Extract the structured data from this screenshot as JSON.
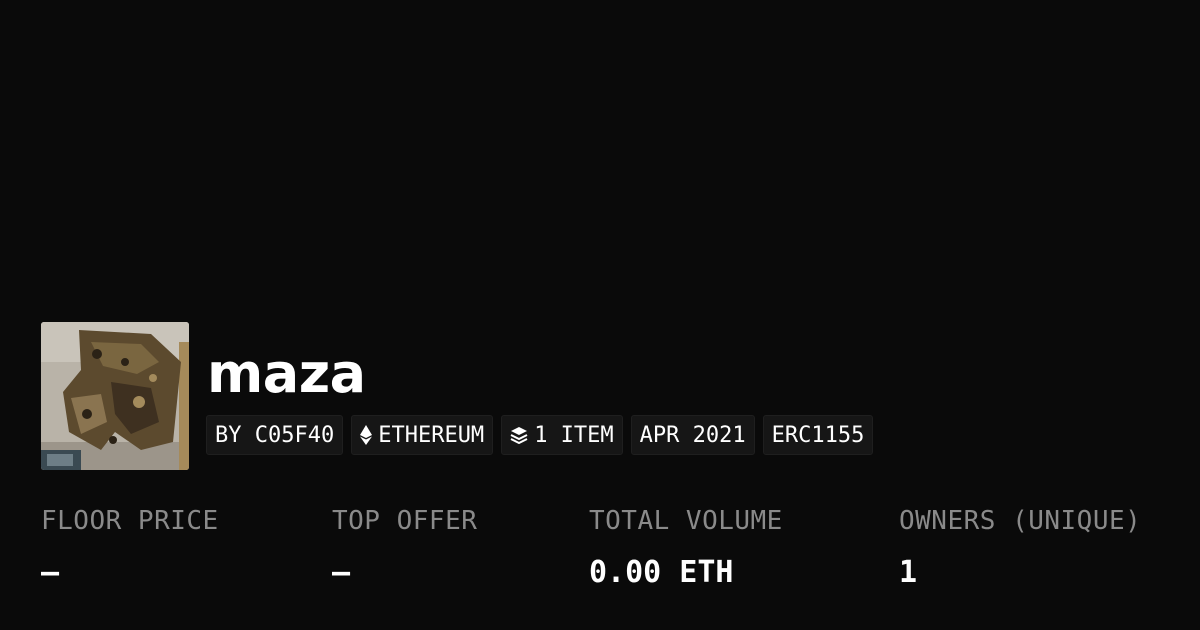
{
  "collection": {
    "title": "maza",
    "thumbnail_alt": "collection-thumbnail"
  },
  "chips": [
    {
      "label": "BY C05F40",
      "icon": ""
    },
    {
      "label": "ETHEREUM",
      "icon": "ethereum-icon"
    },
    {
      "label": "1 ITEM",
      "icon": "layers-icon"
    },
    {
      "label": "APR 2021",
      "icon": ""
    },
    {
      "label": "ERC1155",
      "icon": ""
    }
  ],
  "stats": [
    {
      "label": "FLOOR PRICE",
      "value": "—"
    },
    {
      "label": "TOP OFFER",
      "value": "—"
    },
    {
      "label": "TOTAL VOLUME",
      "value": "0.00 ETH"
    },
    {
      "label": "OWNERS (UNIQUE)",
      "value": "1"
    }
  ],
  "colors": {
    "background": "#0a0a0a",
    "chip_background": "#161616",
    "label_gray": "#8a8a8a",
    "text": "#ffffff"
  }
}
